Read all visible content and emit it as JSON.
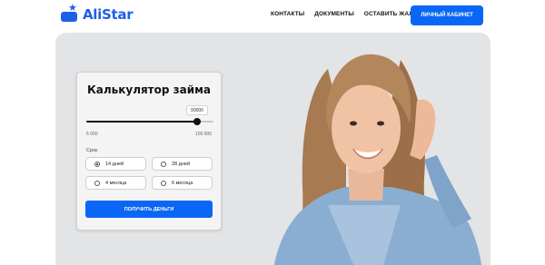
{
  "header": {
    "logo_text": "AliStar",
    "nav": [
      "КОНТАКТЫ",
      "ДОКУМЕНТЫ",
      "ОСТАВИТЬ ЖАЛОБУ"
    ],
    "cabinet_button": "ЛИЧНЫЙ КАБИНЕТ"
  },
  "calculator": {
    "title": "Калькулятор займа",
    "amount": {
      "value": "90000",
      "min_label": "5 000",
      "max_label": "100 000",
      "fill_fraction": 0.9
    },
    "term_label": "Срок",
    "options": [
      {
        "label": "14 дней",
        "selected": true
      },
      {
        "label": "28 дней",
        "selected": false
      },
      {
        "label": "4 месяца",
        "selected": false
      },
      {
        "label": "6 месяца",
        "selected": false
      }
    ],
    "submit_label": "ПОЛУЧИТЬ ДЕНЬГИ"
  },
  "colors": {
    "brand": "#1f5fe8",
    "button": "#0a66f5",
    "hero_bg": "#e3e4e6"
  },
  "icons": {
    "logo": "wallet-star-icon"
  }
}
